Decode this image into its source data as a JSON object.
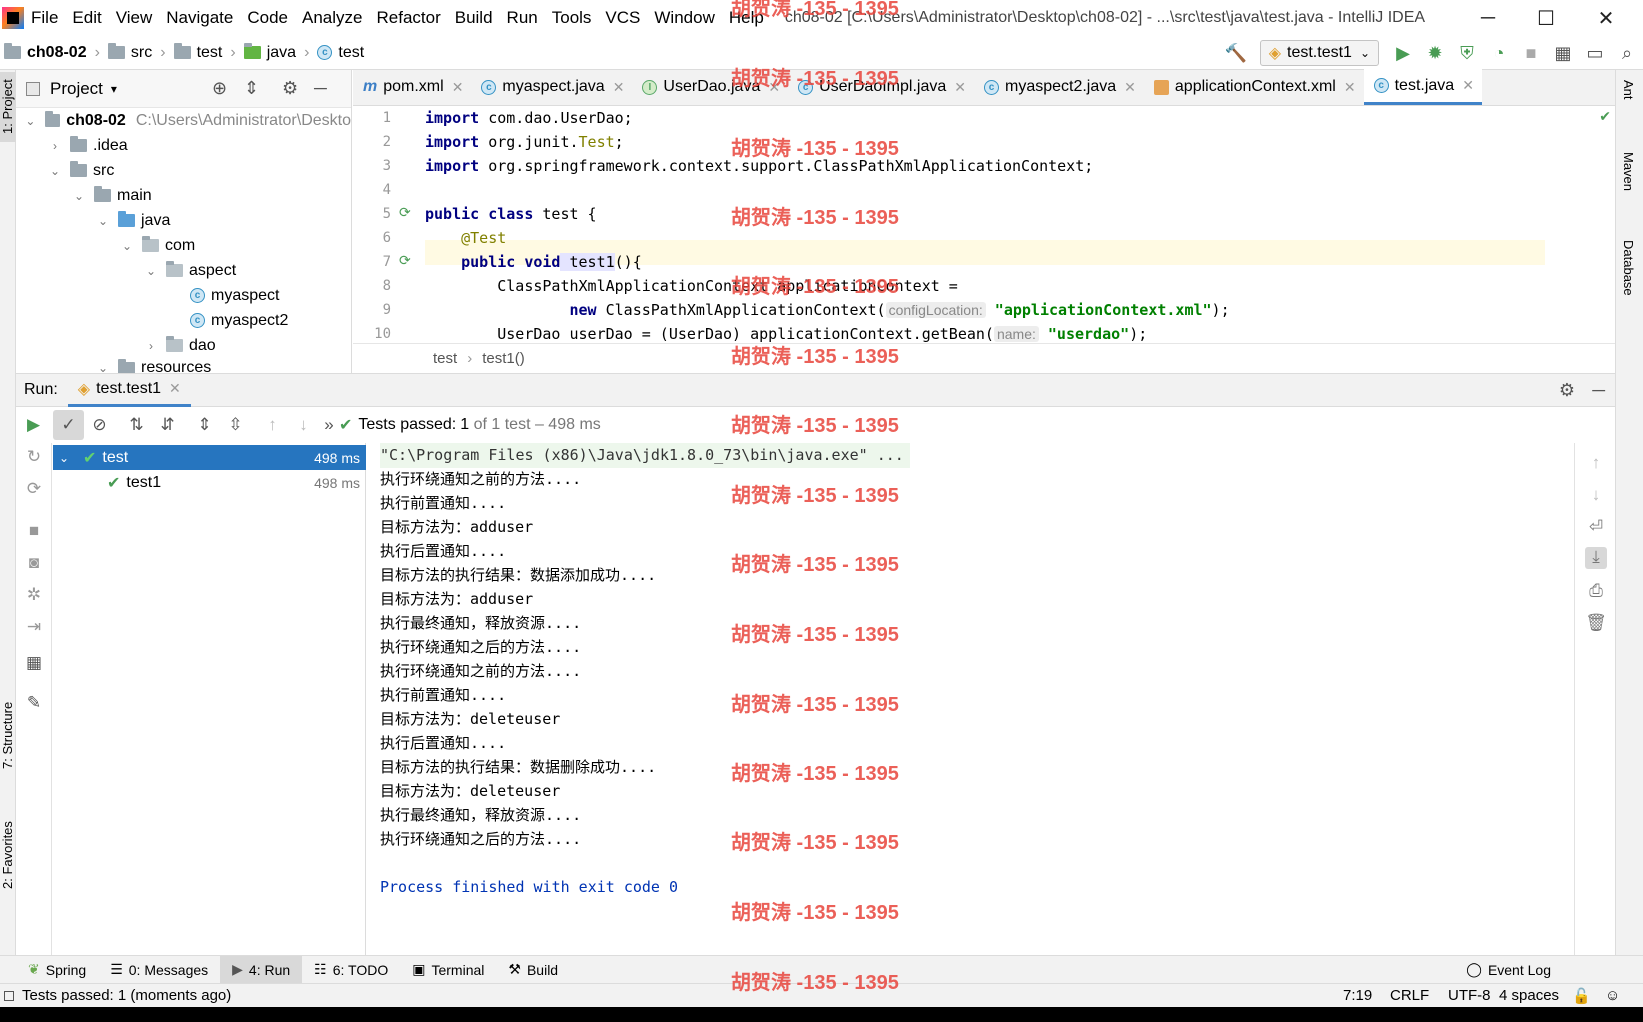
{
  "menu": {
    "items": [
      "File",
      "Edit",
      "View",
      "Navigate",
      "Code",
      "Analyze",
      "Refactor",
      "Build",
      "Run",
      "Tools",
      "VCS",
      "Window",
      "Help"
    ],
    "window_title": "ch08-02 [C:\\Users\\Administrator\\Desktop\\ch08-02] - ...\\src\\test\\java\\test.java - IntelliJ IDEA"
  },
  "window_controls": {
    "minimize": "─",
    "maximize": "☐",
    "close": "✕"
  },
  "breadcrumb": {
    "items": [
      "ch08-02",
      "src",
      "test",
      "java",
      "test"
    ]
  },
  "run_config": {
    "label": "test.test1"
  },
  "left_strip": {
    "project": "1: Project",
    "structure": "7: Structure",
    "favorites": "2: Favorites"
  },
  "right_strip": {
    "ant": "Ant",
    "maven": "Maven",
    "database": "Database"
  },
  "project_panel": {
    "title": "Project",
    "tree": [
      {
        "label": "ch08-02",
        "path": "C:\\Users\\Administrator\\Deskto",
        "depth": 0,
        "expanded": true,
        "kind": "module"
      },
      {
        "label": ".idea",
        "depth": 1,
        "expanded": false,
        "kind": "folder"
      },
      {
        "label": "src",
        "depth": 1,
        "expanded": true,
        "kind": "folder"
      },
      {
        "label": "main",
        "depth": 2,
        "expanded": true,
        "kind": "folder"
      },
      {
        "label": "java",
        "depth": 3,
        "expanded": true,
        "kind": "src-folder"
      },
      {
        "label": "com",
        "depth": 4,
        "expanded": true,
        "kind": "package"
      },
      {
        "label": "aspect",
        "depth": 5,
        "expanded": true,
        "kind": "package"
      },
      {
        "label": "myaspect",
        "depth": 6,
        "kind": "class"
      },
      {
        "label": "myaspect2",
        "depth": 6,
        "kind": "class"
      },
      {
        "label": "dao",
        "depth": 5,
        "expanded": false,
        "kind": "package"
      },
      {
        "label": "resources",
        "depth": 3,
        "expanded": true,
        "kind": "folder"
      }
    ]
  },
  "editor": {
    "tabs": [
      {
        "label": "pom.xml",
        "icon": "maven-icon"
      },
      {
        "label": "myaspect.java",
        "icon": "class-icon"
      },
      {
        "label": "UserDao.java",
        "icon": "interface-icon"
      },
      {
        "label": "UserDaoImpl.java",
        "icon": "class-icon"
      },
      {
        "label": "myaspect2.java",
        "icon": "class-icon"
      },
      {
        "label": "applicationContext.xml",
        "icon": "xml-icon"
      },
      {
        "label": "test.java",
        "icon": "class-icon",
        "active": true
      }
    ],
    "line_numbers": [
      "1",
      "2",
      "3",
      "4",
      "5",
      "6",
      "7",
      "8",
      "9",
      "10"
    ],
    "code": {
      "l1_kw": "import",
      "l1_rest": " com.dao.UserDao;",
      "l2_kw": "import",
      "l2_rest": " org.junit.",
      "l2_ann": "Test",
      "l2_end": ";",
      "l3_kw": "import",
      "l3_rest": " org.springframework.context.support.ClassPathXmlApplicationContext;",
      "l5_kw1": "public",
      "l5_kw2": " class",
      "l5_rest": " test {",
      "l6_ann": "    @Test",
      "l7_kw1": "    public",
      "l7_kw2": " void",
      "l7_name": " test1",
      "l7_rest": "(){",
      "l8_rest": "        ClassPathXmlApplicationContext applicationContext =",
      "l9_kw": "                new",
      "l9_rest": " ClassPathXmlApplicationContext(",
      "l9_hint": "configLocation:",
      "l9_str": "\"applicationContext.xml\"",
      "l9_end": ");",
      "l10_rest": "        UserDao userDao = (UserDao) applicationContext.getBean(",
      "l10_hint": "name:",
      "l10_str": "\"userdao\"",
      "l10_end": ");"
    },
    "crumbs": [
      "test",
      "test1()"
    ]
  },
  "run_panel": {
    "label": "Run:",
    "tab": "test.test1",
    "status_prefix": "Tests passed: ",
    "status_count": "1",
    "status_suffix": " of 1 test – 498 ms",
    "tree": [
      {
        "label": "test",
        "time": "498 ms"
      },
      {
        "label": "test1",
        "time": "498 ms"
      }
    ],
    "console": [
      "\"C:\\Program Files (x86)\\Java\\jdk1.8.0_73\\bin\\java.exe\" ...",
      "执行环绕通知之前的方法....",
      "执行前置通知....",
      "目标方法为：adduser",
      "执行后置通知....",
      "目标方法的执行结果：数据添加成功....",
      "目标方法为：adduser",
      "执行最终通知，释放资源....",
      "执行环绕通知之后的方法....",
      "执行环绕通知之前的方法....",
      "执行前置通知....",
      "目标方法为：deleteuser",
      "执行后置通知....",
      "目标方法的执行结果：数据删除成功....",
      "目标方法为：deleteuser",
      "执行最终通知，释放资源....",
      "执行环绕通知之后的方法....",
      "",
      "Process finished with exit code 0"
    ]
  },
  "bottom_tabs": [
    {
      "label": "Spring"
    },
    {
      "label": "0: Messages"
    },
    {
      "label": "4: Run",
      "active": true
    },
    {
      "label": "6: TODO"
    },
    {
      "label": "Terminal"
    },
    {
      "label": "Build"
    }
  ],
  "event_log": "Event Log",
  "status_bar": {
    "message": "Tests passed: 1 (moments ago)",
    "position": "7:19",
    "line_sep": "CRLF",
    "encoding": "UTF-8",
    "indent": "4 spaces"
  },
  "watermark": "胡贺涛 -135 - 1395",
  "colors": {
    "accent": "#4083c9",
    "success": "#499c54",
    "keyword": "#000080",
    "string": "#008000",
    "annotation": "#808000",
    "selection": "#2675bf"
  }
}
